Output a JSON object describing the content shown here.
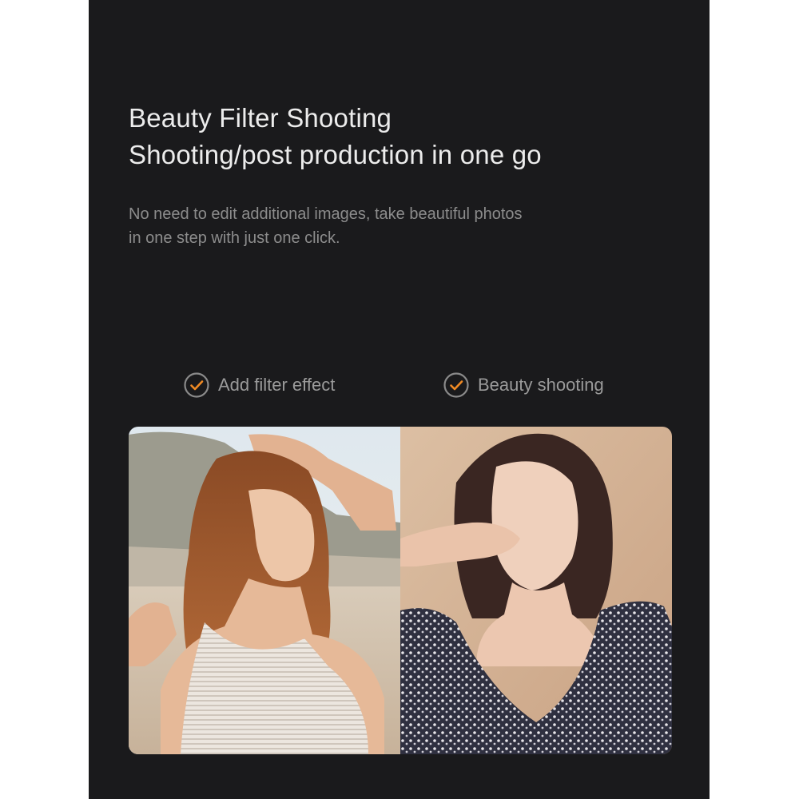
{
  "headline": {
    "line1": "Beauty Filter Shooting",
    "line2": "Shooting/post production in one go"
  },
  "description": {
    "line1": "No need to edit additional images, take beautiful photos",
    "line2": "in one step with just one click."
  },
  "features": [
    {
      "label": "Add filter effect",
      "icon": "check-circle-icon"
    },
    {
      "label": "Beauty shooting",
      "icon": "check-circle-icon"
    }
  ],
  "colors": {
    "panel_bg": "#1a1a1c",
    "accent_orange": "#f08a24",
    "headline_text": "#ececec",
    "body_text": "#8c8c8c"
  },
  "images": [
    {
      "name": "filter-effect-photo",
      "subject": "woman with long auburn hair at beach, white striped tank top"
    },
    {
      "name": "beauty-shooting-photo",
      "subject": "woman with dark bob hair, hand near face, floral ruffled top, beige background"
    }
  ]
}
